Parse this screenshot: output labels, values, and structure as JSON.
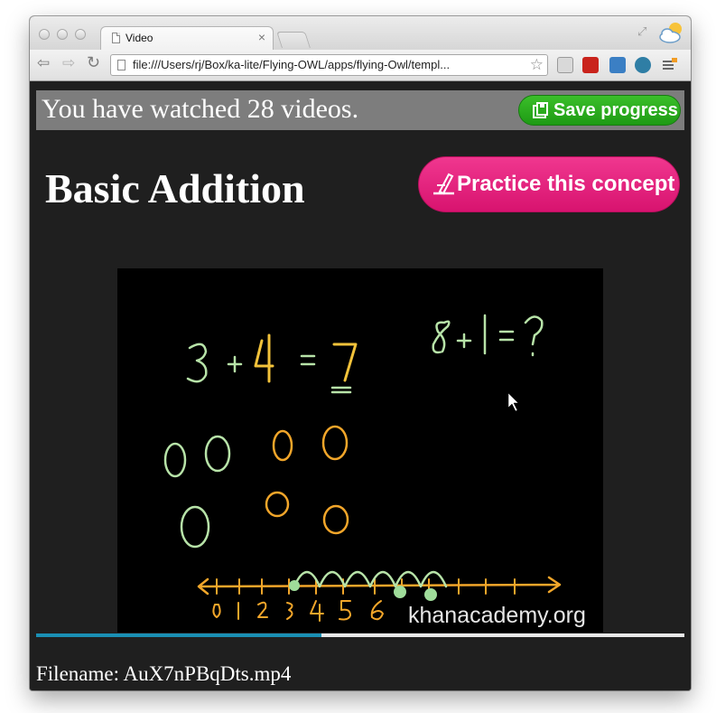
{
  "browser": {
    "tab": {
      "title": "Video",
      "close_glyph": "×"
    },
    "toolbar": {
      "back_icon": "back-arrow-icon",
      "forward_icon": "forward-arrow-icon",
      "reload_icon": "reload-icon",
      "url": "file:///Users/rj/Box/ka-lite/Flying-OWL/apps/flying-Owl/templ..."
    },
    "extensions": [
      "readability-icon",
      "lastpass-icon",
      "screenshot-icon",
      "rss-icon",
      "menu-icon"
    ]
  },
  "page": {
    "progress_text": "You have watched 28 videos.",
    "save_button_label": "Save progress",
    "title": "Basic Addition",
    "practice_button_label": "Practice this concept",
    "video": {
      "watermark": "khanacademy.org",
      "played_fraction": 0.44
    },
    "filename_label": "Filename: AuX7nPBqDts.mp4"
  },
  "colors": {
    "page_background": "#1f1f1f",
    "progress_background": "#7d7d7d",
    "save_button": "#2aab1c",
    "practice_button": "#e8227f",
    "seek_fill": "#1a8fb4"
  }
}
